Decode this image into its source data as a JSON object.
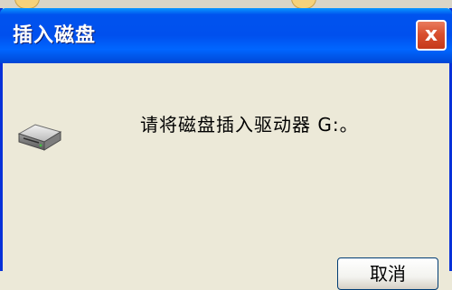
{
  "window": {
    "title": "插入磁盘",
    "close_label": "x"
  },
  "dialog": {
    "message": "请将磁盘插入驱动器 G:。",
    "icon": "disk-drive-icon",
    "cancel_label": "取消"
  },
  "colors": {
    "titlebar": "#0053EE",
    "window_bg": "#ECE9D8",
    "close_button": "#D9502F"
  }
}
